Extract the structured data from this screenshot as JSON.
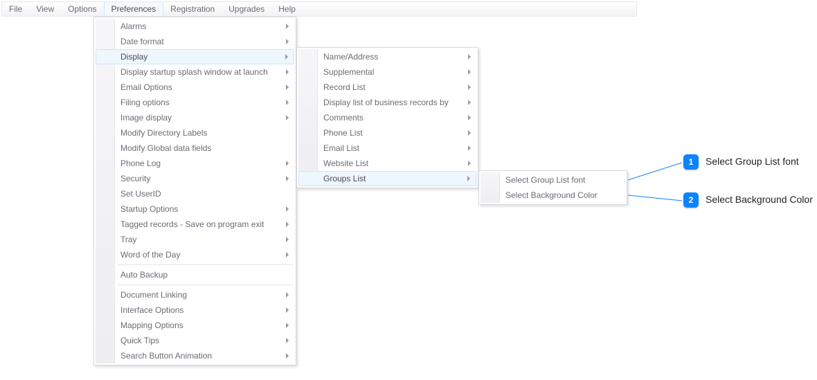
{
  "menubar": {
    "file": "File",
    "view": "View",
    "options": "Options",
    "preferences": "Preferences",
    "registration": "Registration",
    "upgrades": "Upgrades",
    "help": "Help"
  },
  "preferences_menu": {
    "alarms": "Alarms",
    "date_format": "Date format",
    "display": "Display",
    "display_splash": "Display startup splash window at launch",
    "email_options": "Email Options",
    "filing_options": "Filing options",
    "image_display": "Image display",
    "modify_directory_labels": "Modify Directory Labels",
    "modify_global_fields": "Modify Global data fields",
    "phone_log": "Phone Log",
    "security": "Security",
    "set_userid": "Set UserID",
    "startup_options": "Startup Options",
    "tagged_records": "Tagged records - Save on program exit",
    "tray": "Tray",
    "word_of_day": "Word of the Day",
    "auto_backup": "Auto Backup",
    "document_linking": "Document Linking",
    "interface_options": "Interface Options",
    "mapping_options": "Mapping Options",
    "quick_tips": "Quick Tips",
    "search_button_animation": "Search Button Animation"
  },
  "display_menu": {
    "name_address": "Name/Address",
    "supplemental": "Supplemental",
    "record_list": "Record List",
    "business_records": "Display list of business records by",
    "comments": "Comments",
    "phone_list": "Phone List",
    "email_list": "Email List",
    "website_list": "Website List",
    "groups_list": "Groups List"
  },
  "groups_list_menu": {
    "select_font": "Select Group List font",
    "select_bg": "Select Background Color"
  },
  "callouts": {
    "n1": "1",
    "n2": "2",
    "t1": "Select Group List font",
    "t2": "Select Background Color"
  }
}
